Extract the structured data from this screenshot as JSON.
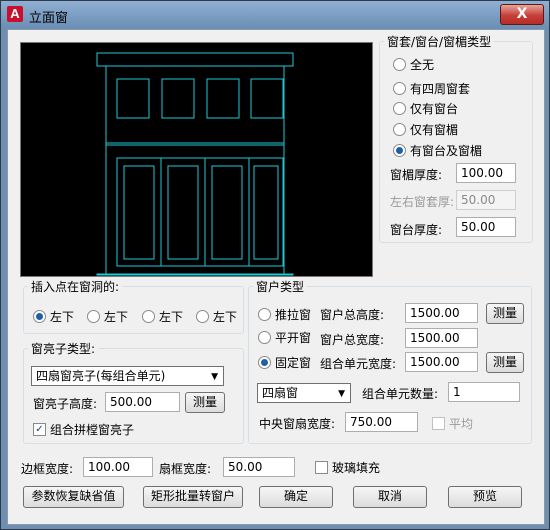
{
  "window": {
    "title": "立面窗",
    "close_label": "X"
  },
  "style_group": {
    "legend": "窗套/窗台/窗楣类型",
    "options": [
      "全无",
      "有四周窗套",
      "仅有窗台",
      "仅有窗楣",
      "有窗台及窗楣"
    ],
    "selected_index": 4,
    "lintel_thickness_label": "窗楣厚度:",
    "lintel_thickness_value": "100.00",
    "side_casing_label": "左右窗套厚:",
    "side_casing_value": "50.00",
    "sill_thickness_label": "窗台厚度:",
    "sill_thickness_value": "50.00"
  },
  "insert_group": {
    "legend": "插入点在窗洞的:",
    "options": [
      "左下",
      "左下",
      "左下",
      "左下"
    ],
    "selected_index": 0
  },
  "mullion_group": {
    "legend": "窗亮子类型:",
    "type_value": "四扇窗亮子(每组合单元)",
    "height_label": "窗亮子高度:",
    "height_value": "500.00",
    "measure_label": "测量",
    "combine_label": "组合拼樘窗亮子",
    "combine_checked": true
  },
  "window_type_group": {
    "legend": "窗户类型",
    "types": [
      "推拉窗",
      "平开窗",
      "固定窗"
    ],
    "selected_index": 2,
    "total_height_label": "窗户总高度:",
    "total_height_value": "1500.00",
    "total_width_label": "窗户总宽度:",
    "total_width_value": "1500.00",
    "unit_width_label": "组合单元宽度:",
    "unit_width_value": "1500.00",
    "measure_label": "测量",
    "sash_select_value": "四扇窗",
    "unit_count_label": "组合单元数量:",
    "unit_count_value": "1",
    "center_sash_label": "中央窗扇宽度:",
    "center_sash_value": "750.00",
    "average_label": "平均",
    "average_checked": false
  },
  "frame": {
    "border_width_label": "边框宽度:",
    "border_width_value": "100.00",
    "sash_frame_label": "扇框宽度:",
    "sash_frame_value": "50.00",
    "glass_fill_label": "玻璃填充",
    "glass_fill_checked": false
  },
  "buttons": {
    "restore_defaults": "参数恢复缺省值",
    "batch_convert": "矩形批量转窗户",
    "ok": "确定",
    "cancel": "取消",
    "preview": "预览"
  },
  "colors": {
    "preview_bg": "#000000",
    "drawing_stroke": "#1fc8d6",
    "radio_accent": "#1f5fa8"
  }
}
